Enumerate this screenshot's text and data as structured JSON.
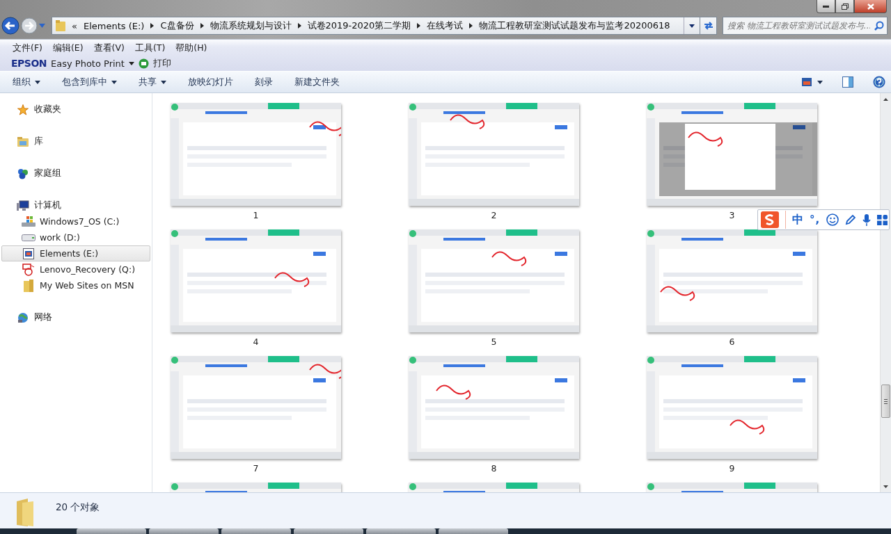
{
  "address": {
    "overflow": "«",
    "crumbs": [
      "Elements (E:)",
      "C盘备份",
      "物流系统规划与设计",
      "试卷2019-2020第二学期",
      "在线考试",
      "物流工程教研室测试试题发布与监考20200618"
    ]
  },
  "search": {
    "placeholder": "搜索 物流工程教研室测试试题发布与..."
  },
  "menu": [
    "文件(F)",
    "编辑(E)",
    "查看(V)",
    "工具(T)",
    "帮助(H)"
  ],
  "epson": {
    "brand": "EPSON",
    "app": "Easy Photo Print",
    "print": "打印"
  },
  "commands": [
    {
      "label": "组织",
      "dropdown": true
    },
    {
      "label": "包含到库中",
      "dropdown": true
    },
    {
      "label": "共享",
      "dropdown": true
    },
    {
      "label": "放映幻灯片",
      "dropdown": false
    },
    {
      "label": "刻录",
      "dropdown": false
    },
    {
      "label": "新建文件夹",
      "dropdown": false
    }
  ],
  "sidebar": {
    "groups": [
      {
        "label": "收藏夹",
        "kind": "favorites"
      },
      {
        "label": "库",
        "kind": "library"
      },
      {
        "label": "家庭组",
        "kind": "homegroup"
      },
      {
        "label": "计算机",
        "kind": "computer",
        "children": [
          {
            "label": "Windows7_OS (C:)",
            "kind": "osdrive",
            "selected": false
          },
          {
            "label": "work (D:)",
            "kind": "drive",
            "selected": false
          },
          {
            "label": "Elements (E:)",
            "kind": "external",
            "selected": true
          },
          {
            "label": "Lenovo_Recovery (Q:)",
            "kind": "recovery",
            "selected": false
          },
          {
            "label": "My Web Sites on MSN",
            "kind": "folder",
            "selected": false
          }
        ]
      },
      {
        "label": "网络",
        "kind": "network"
      }
    ]
  },
  "files": [
    {
      "kind": "picture",
      "caption": "1"
    },
    {
      "kind": "picture",
      "caption": "2"
    },
    {
      "kind": "picture",
      "caption": "3"
    },
    {
      "kind": "picture",
      "caption": "4"
    },
    {
      "kind": "picture",
      "caption": "5"
    },
    {
      "kind": "picture",
      "caption": "6"
    },
    {
      "kind": "picture",
      "caption": "7"
    },
    {
      "kind": "picture",
      "caption": "8"
    },
    {
      "kind": "picture",
      "caption": "9"
    },
    {
      "kind": "picture"
    },
    {
      "kind": "picture"
    },
    {
      "kind": "picture"
    }
  ],
  "status_bar": {
    "count": "20 个对象"
  },
  "ime": {
    "mode": "中",
    "punctuation": "°,"
  }
}
